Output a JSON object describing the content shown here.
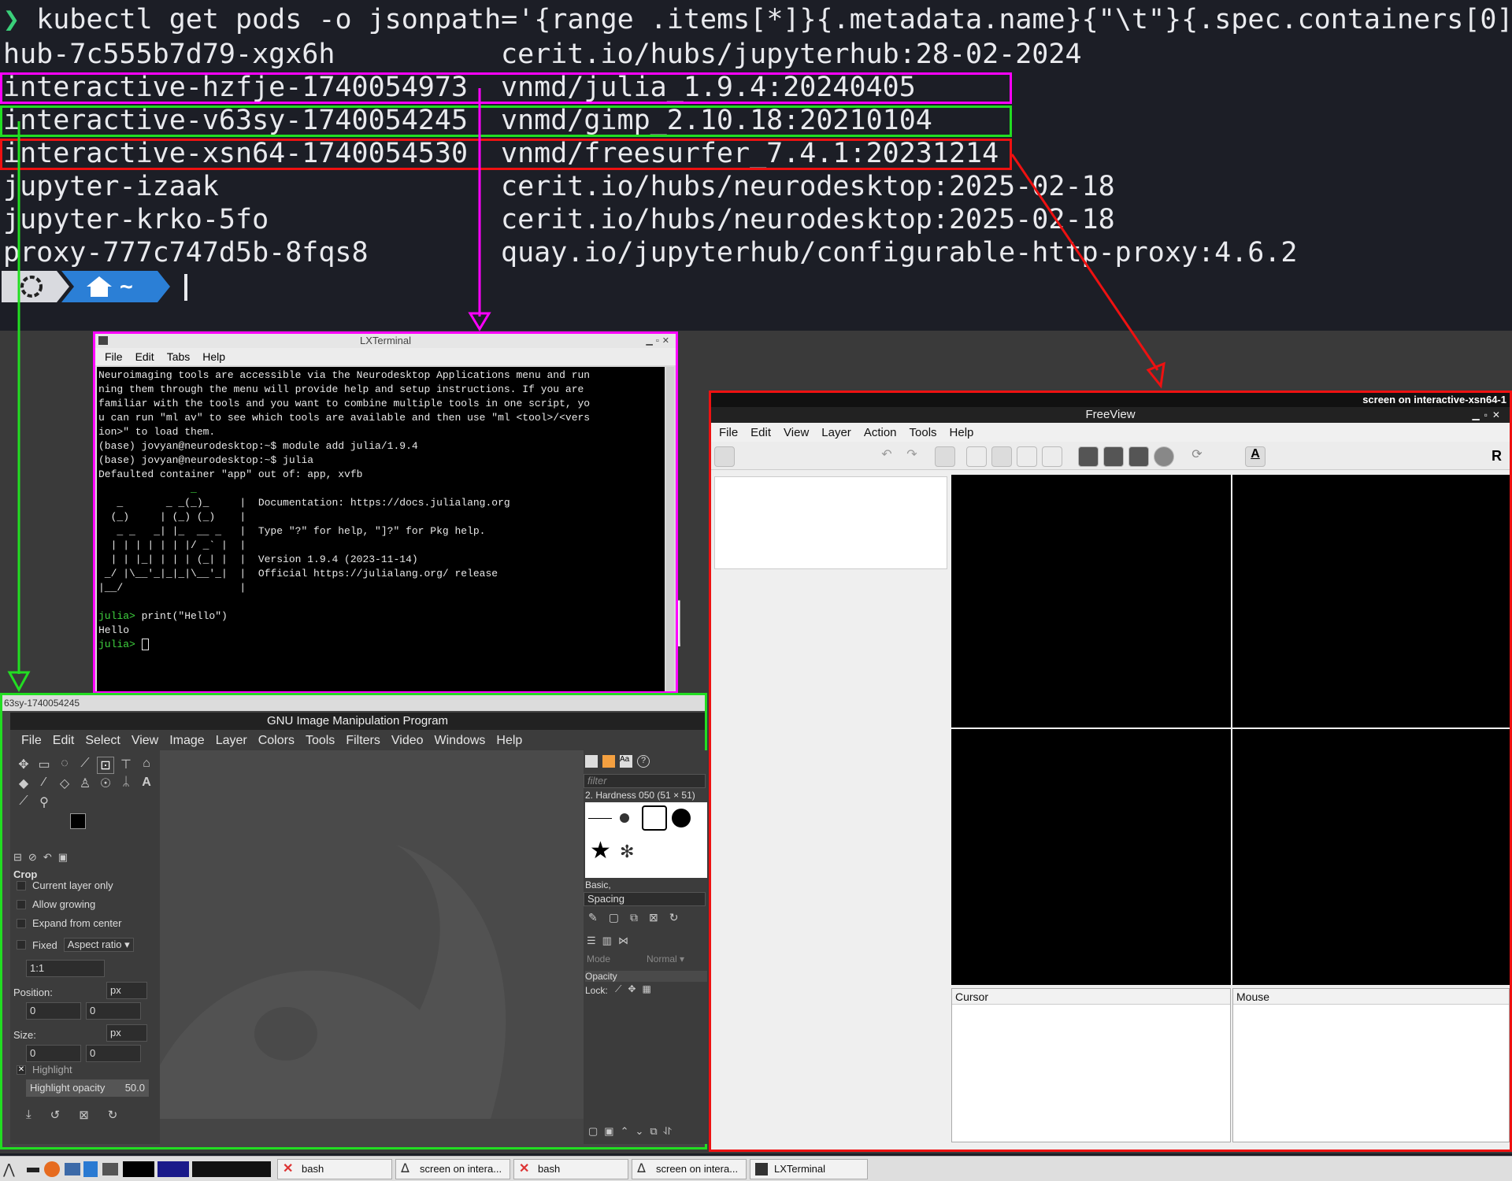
{
  "terminal": {
    "command": "kubectl get pods -o jsonpath='{range .items[*]}{.metadata.name}{\"\\t\"}{.spec.containers[0]",
    "prompt_symbol": "❯",
    "rows": [
      {
        "pod": "hub-7c555b7d79-xgx6h",
        "image": "cerit.io/hubs/jupyterhub:28-02-2024"
      },
      {
        "pod": "interactive-hzfje-1740054973",
        "image": "vnmd/julia_1.9.4:20240405"
      },
      {
        "pod": "interactive-v63sy-1740054245",
        "image": "vnmd/gimp_2.10.18:20210104"
      },
      {
        "pod": "interactive-xsn64-1740054530",
        "image": "vnmd/freesurfer_7.4.1:20231214"
      },
      {
        "pod": "jupyter-izaak",
        "image": "cerit.io/hubs/neurodesktop:2025-02-18"
      },
      {
        "pod": "jupyter-krko-5fo",
        "image": "cerit.io/hubs/neurodesktop:2025-02-18"
      },
      {
        "pod": "proxy-777c747d5b-8fqs8",
        "image": "quay.io/jupyterhub/configurable-http-proxy:4.6.2"
      }
    ],
    "path_segment": "~",
    "highlight_colors": {
      "julia": "#ff00ff",
      "gimp": "#22dd22",
      "freesurfer": "#ee1111"
    }
  },
  "desktop": {
    "bg_letter": "u"
  },
  "lxterminal": {
    "title": "LXTerminal",
    "menu": [
      "File",
      "Edit",
      "Tabs",
      "Help"
    ],
    "lines": [
      "Neuroimaging tools are accessible via the Neurodesktop Applications menu and run",
      "ning them through the menu will provide help and setup instructions. If you are",
      "familiar with the tools and you want to combine multiple tools in one script, yo",
      "u can run \"ml av\" to see which tools are available and then use \"ml <tool>/<vers",
      "ion>\" to load them.",
      "(base) jovyan@neurodesktop:~$ module add julia/1.9.4",
      "(base) jovyan@neurodesktop:~$ julia",
      "Defaulted container \"app\" out of: app, xvfb",
      "",
      "               _",
      "   _       _ _(_)_     |  Documentation: https://docs.julialang.org",
      "  (_)     | (_) (_)    |",
      "   _ _   _| |_  __ _   |  Type \"?\" for help, \"]?\" for Pkg help.",
      "  | | | | | | |/ _` |  |",
      "  | | |_| | | | (_| |  |  Version 1.9.4 (2023-11-14)",
      " _/ |\\__'_|_|_|\\__'_|  |  Official https://julialang.org/ release",
      "|__/                   |",
      ""
    ],
    "repl_prompt": "julia>",
    "repl_command": " print(\"Hello\")",
    "repl_output": "Hello",
    "repl_prompt2": "julia>"
  },
  "gimp": {
    "screen_label": "63sy-1740054245",
    "title": "GNU Image Manipulation Program",
    "menu": [
      "File",
      "Edit",
      "Select",
      "View",
      "Image",
      "Layer",
      "Colors",
      "Tools",
      "Filters",
      "Video",
      "Windows",
      "Help"
    ],
    "tool_options": {
      "tool": "Crop",
      "current_layer_only": "Current layer only",
      "allow_growing": "Allow growing",
      "expand_from_center": "Expand from center",
      "fixed": "Fixed",
      "fixed_option": "Aspect ratio",
      "ratio": "1:1",
      "position_label": "Position:",
      "position_unit": "px",
      "position_x": "0",
      "position_y": "0",
      "size_label": "Size:",
      "size_unit": "px",
      "size_w": "0",
      "size_h": "0",
      "highlight": "Highlight",
      "highlight_opacity_label": "Highlight opacity",
      "highlight_opacity_value": "50.0"
    },
    "brushes": {
      "filter_placeholder": "filter",
      "selected": "2. Hardness 050 (51 × 51)",
      "tag": "Basic,",
      "spacing": "Spacing"
    },
    "layers": {
      "mode_label": "Mode",
      "mode_value": "Normal",
      "opacity_label": "Opacity",
      "lock_label": "Lock:"
    }
  },
  "freeview": {
    "screen_label": "screen on interactive-xsn64-1",
    "title": "FreeView",
    "menu": [
      "File",
      "Edit",
      "View",
      "Layer",
      "Action",
      "Tools",
      "Help"
    ],
    "toolbar_letter": "R",
    "cursor_label": "Cursor",
    "mouse_label": "Mouse"
  },
  "taskbar": {
    "buttons": [
      {
        "label": "bash",
        "icon": "x-terminal-icon"
      },
      {
        "label": "screen on intera...",
        "icon": "freeview-icon"
      },
      {
        "label": "bash",
        "icon": "x-terminal-icon"
      },
      {
        "label": "screen on intera...",
        "icon": "freeview-icon"
      },
      {
        "label": "LXTerminal",
        "icon": "terminal-icon"
      }
    ]
  }
}
